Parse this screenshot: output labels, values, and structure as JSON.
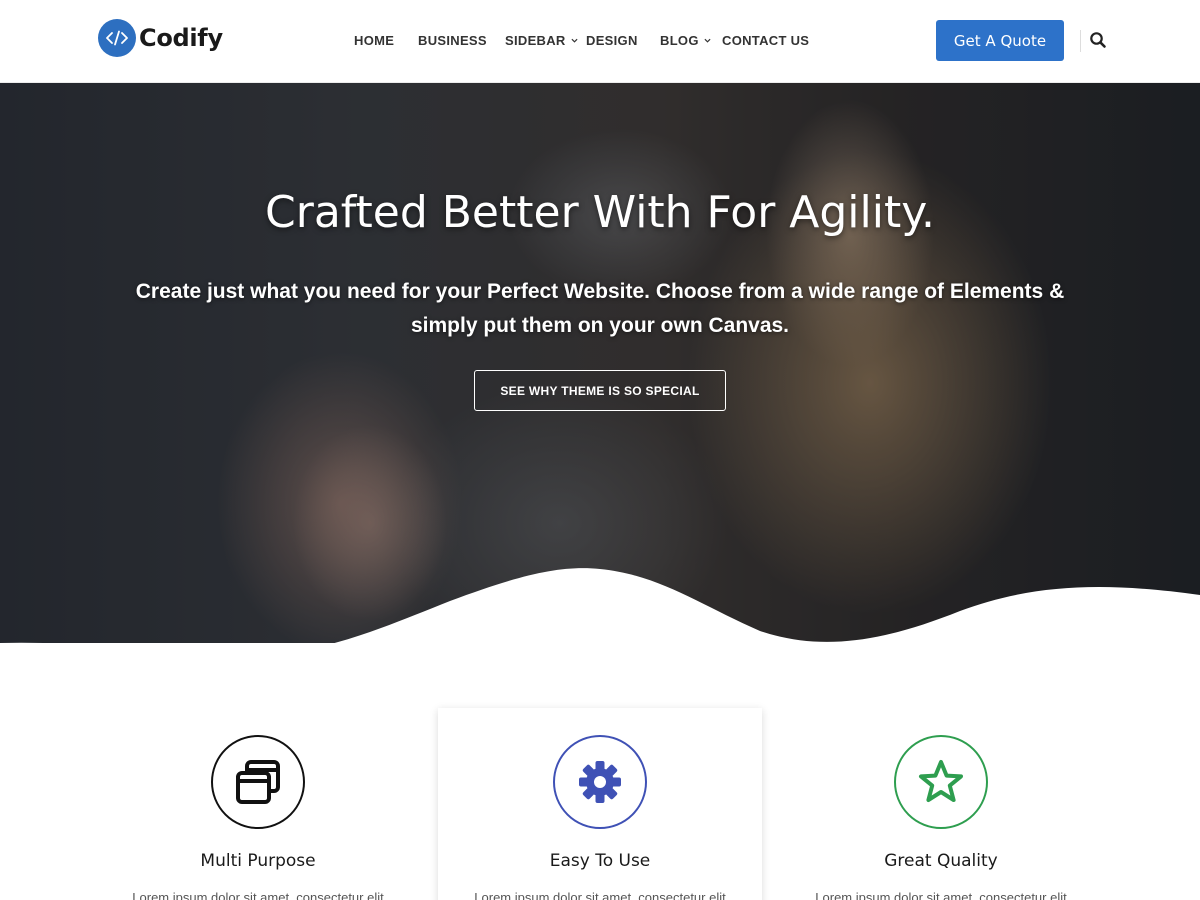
{
  "header": {
    "logo_text": "Codify",
    "nav": [
      {
        "label": "HOME",
        "has_dropdown": false
      },
      {
        "label": "BUSINESS",
        "has_dropdown": false
      },
      {
        "label": "SIDEBAR",
        "has_dropdown": true
      },
      {
        "label": "DESIGN",
        "has_dropdown": false
      },
      {
        "label": "BLOG",
        "has_dropdown": true
      },
      {
        "label": "CONTACT US",
        "has_dropdown": false
      }
    ],
    "quote_button": "Get A Quote"
  },
  "hero": {
    "title": "Crafted Better With For Agility.",
    "subtitle_line1": "Create just what you need for your Perfect Website. Choose from a wide range of Elements &",
    "subtitle_line2": "simply put them on your own Canvas.",
    "button": "SEE WHY THEME IS SO SPECIAL"
  },
  "features": [
    {
      "title": "Multi Purpose",
      "text": "Lorem ipsum dolor sit amet, consectetur elit",
      "icon": "windows-icon",
      "color": "#111111"
    },
    {
      "title": "Easy To Use",
      "text": "Lorem ipsum dolor sit amet, consectetur elit",
      "icon": "gear-icon",
      "color": "#3f51b5"
    },
    {
      "title": "Great Quality",
      "text": "Lorem ipsum dolor sit amet, consectetur elit",
      "icon": "star-icon",
      "color": "#2e9e4f"
    }
  ],
  "colors": {
    "accent": "#2d72c9",
    "logo": "#2d6fc0"
  }
}
